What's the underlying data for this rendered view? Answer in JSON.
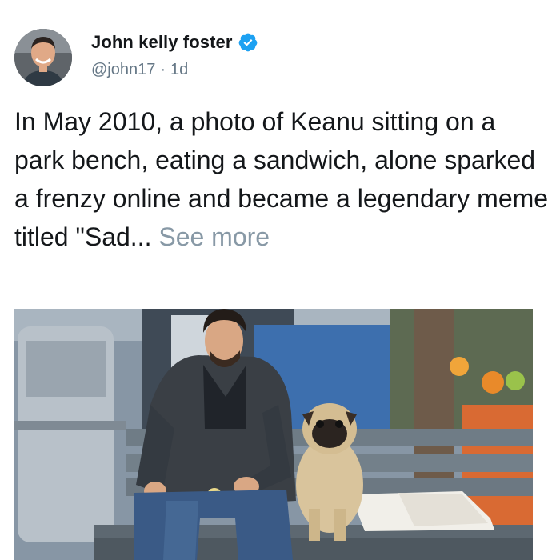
{
  "tweet": {
    "author": {
      "display_name": "John kelly foster",
      "handle": "@john17",
      "time_ago": "1d",
      "separator": "·",
      "verified": true,
      "avatar_icon": "person-avatar-icon",
      "verified_icon": "verified-badge-icon",
      "verified_color": "#1da1f2"
    },
    "text": "In May 2010, a photo of Keanu sitting on a park bench, eating a sandwich, alone sparked a frenzy online and became a legendary meme titled \"Sad...",
    "see_more_label": "See more",
    "media": {
      "icon": "photo-man-with-pug-on-bench"
    }
  },
  "colors": {
    "text_primary": "#14171a",
    "text_secondary": "#657786",
    "link_muted": "#8899a6",
    "background": "#ffffff"
  }
}
